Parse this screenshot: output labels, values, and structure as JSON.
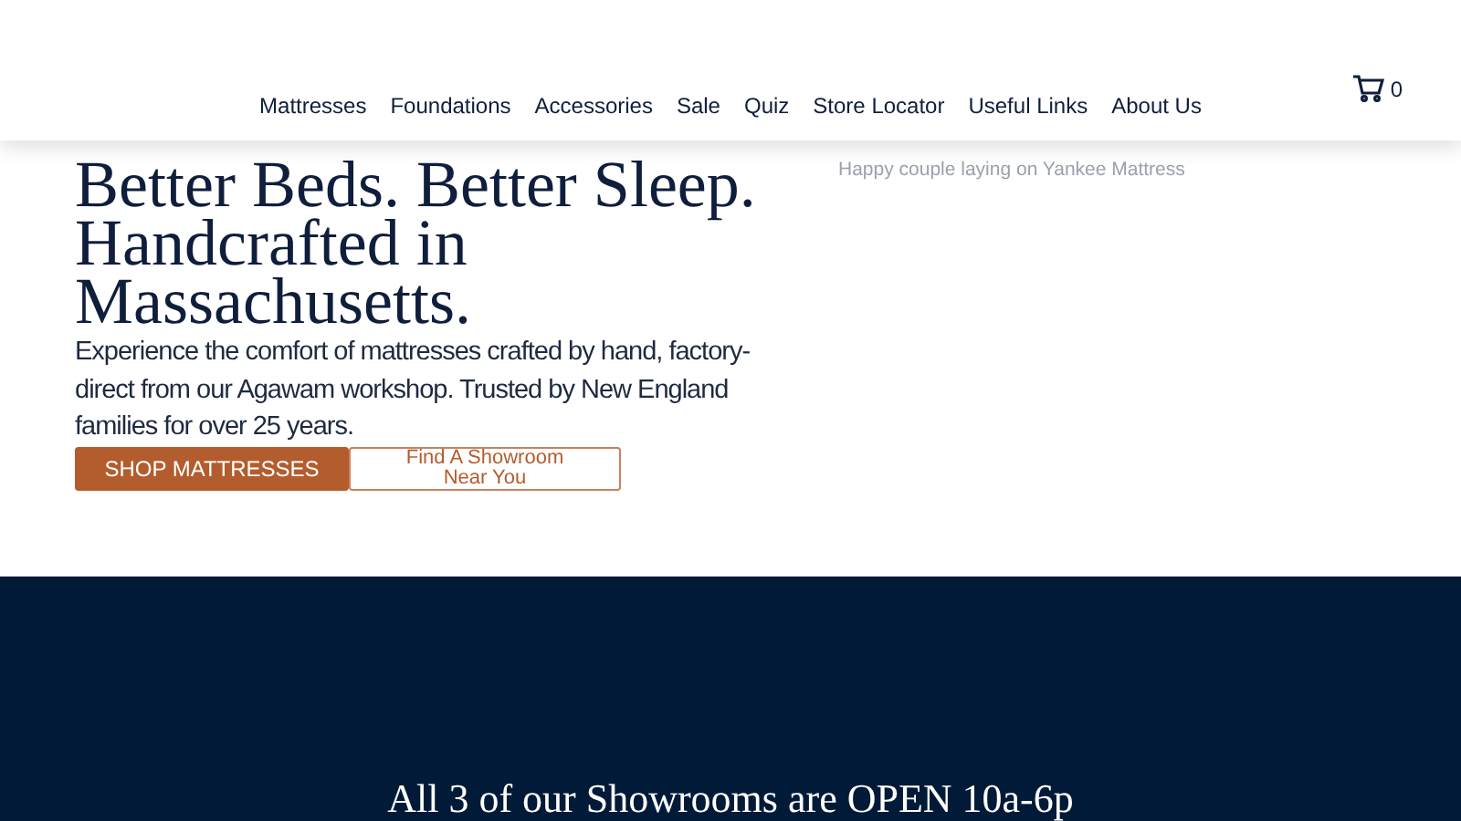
{
  "nav": {
    "items": [
      "Mattresses",
      "Foundations",
      "Accessories",
      "Sale",
      "Quiz",
      "Store Locator",
      "Useful Links",
      "About Us"
    ],
    "cart_count": "0"
  },
  "hero": {
    "title_lines": [
      "Better Beds. Better Sleep.",
      "Handcrafted in",
      "Massachusetts."
    ],
    "body": "Experience the comfort of mattresses crafted by hand, factory-direct from our Agawam workshop. Trusted by New England families for over 25 years.",
    "primary_button": "SHOP MATTRESSES",
    "secondary_button": "Find A Showroom Near You",
    "image_alt": "Happy couple laying on Yankee Mattress"
  },
  "banner": {
    "heading": "All 3 of our Showrooms are OPEN 10a-6p"
  }
}
